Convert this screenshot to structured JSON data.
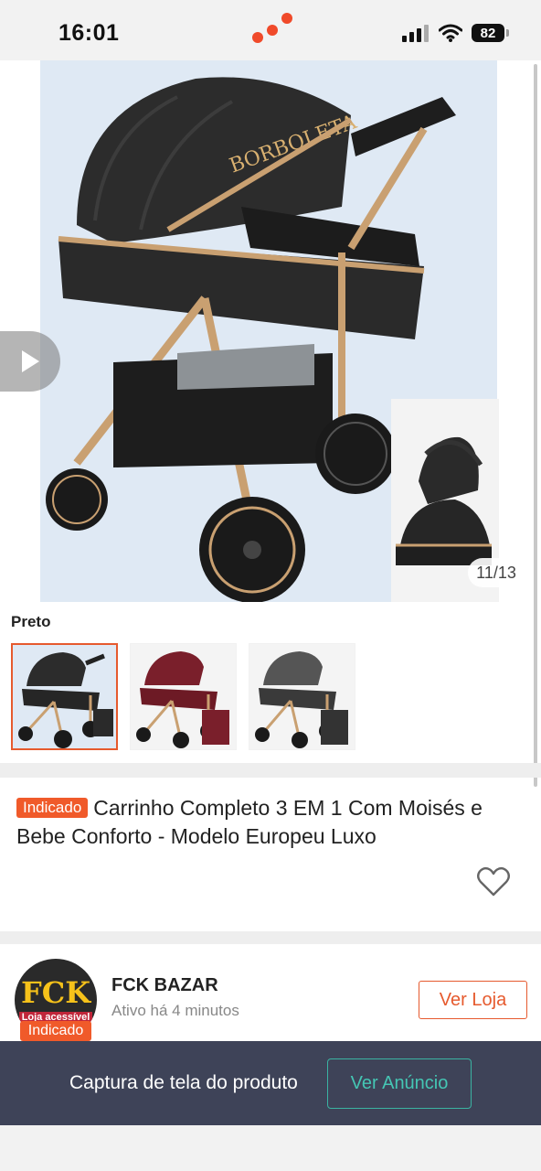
{
  "status_bar": {
    "time": "16:01",
    "battery": "82"
  },
  "gallery": {
    "counter": "11/13",
    "brand_text": "BORBOLETA"
  },
  "variant": {
    "label": "Preto",
    "thumbnails": [
      {
        "color": "black",
        "selected": true
      },
      {
        "color": "burgundy",
        "selected": false
      },
      {
        "color": "grey",
        "selected": false
      }
    ]
  },
  "product": {
    "badge": "Indicado",
    "title": "Carrinho Completo 3 EM 1 Com Moisés e Bebe Conforto - Modelo Europeu Luxo"
  },
  "store": {
    "avatar_text": "FCK",
    "avatar_subtext": "Loja acessível",
    "badge": "Indicado",
    "name": "FCK BAZAR",
    "active": "Ativo há 4 minutos",
    "button": "Ver Loja"
  },
  "capture": {
    "text": "Captura de tela do produto",
    "button": "Ver Anúncio"
  },
  "colors": {
    "accent": "#e65a2e",
    "badge": "#f05a2a",
    "capture_bar": "#3e4358",
    "teal": "#45c6b4"
  }
}
